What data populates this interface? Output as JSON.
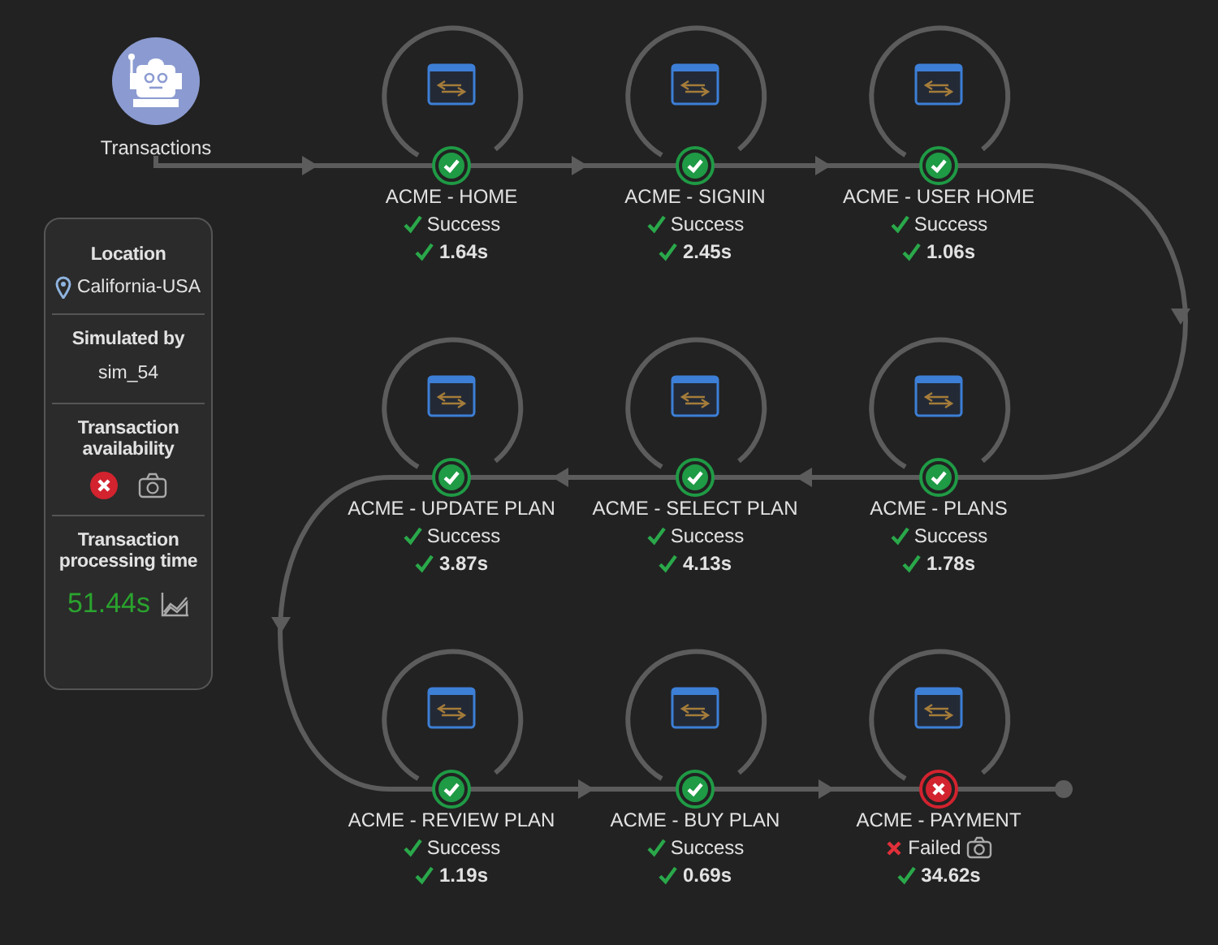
{
  "source": {
    "label": "Transactions"
  },
  "details": {
    "location_label": "Location",
    "location": "California-USA",
    "simulated_label": "Simulated by",
    "simulated_by": "sim_54",
    "availability_label": "Transaction availability",
    "available": false,
    "time_label": "Transaction processing time",
    "time": "51.44s"
  },
  "steps": [
    {
      "name": "ACME - HOME",
      "failed": false,
      "status_text": "Success",
      "time": "1.64s"
    },
    {
      "name": "ACME - SIGNIN",
      "failed": false,
      "status_text": "Success",
      "time": "2.45s"
    },
    {
      "name": "ACME - USER HOME",
      "failed": false,
      "status_text": "Success",
      "time": "1.06s"
    },
    {
      "name": "ACME - UPDATE PLAN",
      "failed": false,
      "status_text": "Success",
      "time": "3.87s"
    },
    {
      "name": "ACME - SELECT PLAN",
      "failed": false,
      "status_text": "Success",
      "time": "4.13s"
    },
    {
      "name": "ACME - PLANS",
      "failed": false,
      "status_text": "Success",
      "time": "1.78s"
    },
    {
      "name": "ACME - REVIEW PLAN",
      "failed": false,
      "status_text": "Success",
      "time": "1.19s"
    },
    {
      "name": "ACME - BUY PLAN",
      "failed": false,
      "status_text": "Success",
      "time": "0.69s"
    },
    {
      "name": "ACME - PAYMENT",
      "failed": true,
      "status_text": "Failed",
      "time": "34.62s"
    }
  ]
}
